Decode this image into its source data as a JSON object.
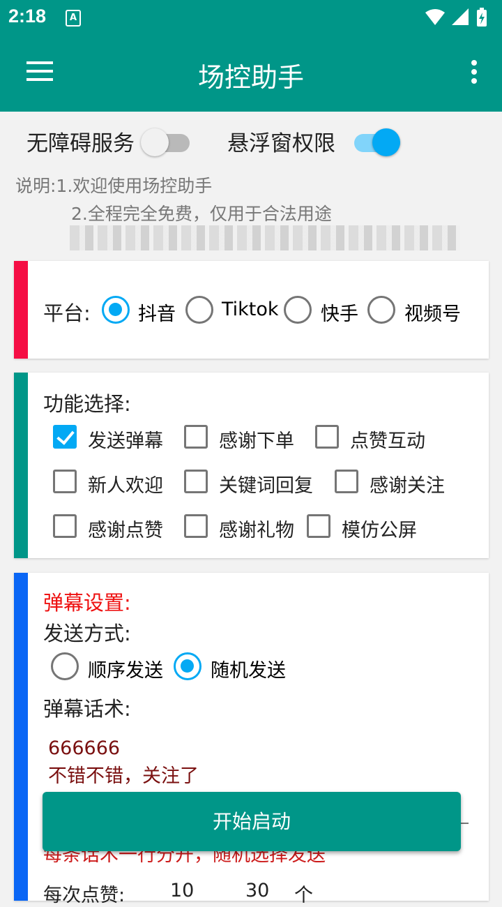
{
  "status": {
    "time": "2:18",
    "badge": "A"
  },
  "app_bar": {
    "title": "场控助手"
  },
  "permissions": {
    "accessibility": {
      "label": "无障碍服务",
      "on": false
    },
    "overlay": {
      "label": "悬浮窗权限",
      "on": true
    }
  },
  "description": {
    "line1": "说明:1.欢迎使用场控助手",
    "line2": "2.全程完全免费，仅用于合法用途"
  },
  "platform": {
    "label": "平台:",
    "options": [
      "抖音",
      "Tiktok",
      "快手",
      "视频号"
    ],
    "selected": "抖音"
  },
  "features": {
    "label": "功能选择:",
    "items": [
      {
        "label": "发送弹幕",
        "checked": true
      },
      {
        "label": "感谢下单",
        "checked": false
      },
      {
        "label": "点赞互动",
        "checked": false
      },
      {
        "label": "新人欢迎",
        "checked": false
      },
      {
        "label": "关键词回复",
        "checked": false
      },
      {
        "label": "感谢关注",
        "checked": false
      },
      {
        "label": "感谢点赞",
        "checked": false
      },
      {
        "label": "感谢礼物",
        "checked": false
      },
      {
        "label": "模仿公屏",
        "checked": false
      }
    ]
  },
  "danmu": {
    "title": "弹幕设置:",
    "send_mode_label": "发送方式:",
    "modes": [
      "顺序发送",
      "随机发送"
    ],
    "selected_mode": "随机发送",
    "script_label": "弹幕话术:",
    "script_lines": [
      "666666",
      "不错不错，关注了"
    ],
    "hint": "每条话术一行分开，随机选择发送",
    "like_label": "每次点赞:",
    "like_min": "10",
    "like_max": "30",
    "like_unit": "个"
  },
  "start_button": {
    "label": "开始启动"
  },
  "colors": {
    "primary": "#009688",
    "accent": "#03a9f4",
    "strip_platform": "#f50e44",
    "strip_features": "#009688",
    "strip_danmu": "#0a66f5",
    "red_text": "#ee1111",
    "script_text": "#7a1010"
  }
}
